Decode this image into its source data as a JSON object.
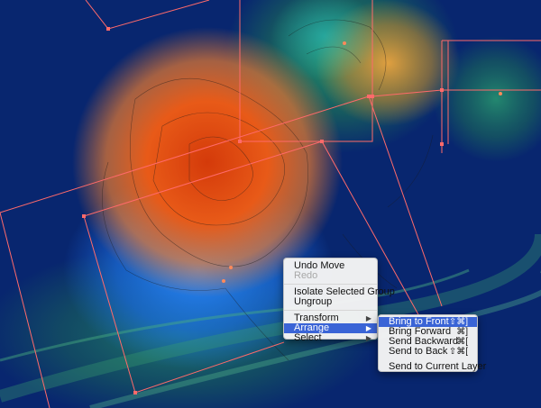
{
  "context_menu": {
    "items": [
      {
        "label": "Undo Move",
        "enabled": true
      },
      {
        "label": "Redo",
        "enabled": false
      },
      {
        "label": "Isolate Selected Group",
        "enabled": true
      },
      {
        "label": "Ungroup",
        "enabled": true
      },
      {
        "label": "Transform",
        "enabled": true,
        "submenu": true
      },
      {
        "label": "Arrange",
        "enabled": true,
        "submenu": true,
        "highlighted": true
      },
      {
        "label": "Select",
        "enabled": true,
        "submenu": true
      }
    ],
    "arrow_glyph": "▶"
  },
  "arrange_submenu": {
    "items": [
      {
        "label": "Bring to Front",
        "shortcut": "⇧⌘]",
        "highlighted": true
      },
      {
        "label": "Bring Forward",
        "shortcut": "⌘]"
      },
      {
        "label": "Send Backward",
        "shortcut": "⌘["
      },
      {
        "label": "Send to Back",
        "shortcut": "⇧⌘["
      },
      {
        "label": "Send to Current Layer",
        "shortcut": ""
      }
    ]
  },
  "colors": {
    "background": "#0a2a7a",
    "orange_blob": "#e04a10",
    "selection": "#ff6a6a",
    "highlight": "#3a64d6"
  }
}
